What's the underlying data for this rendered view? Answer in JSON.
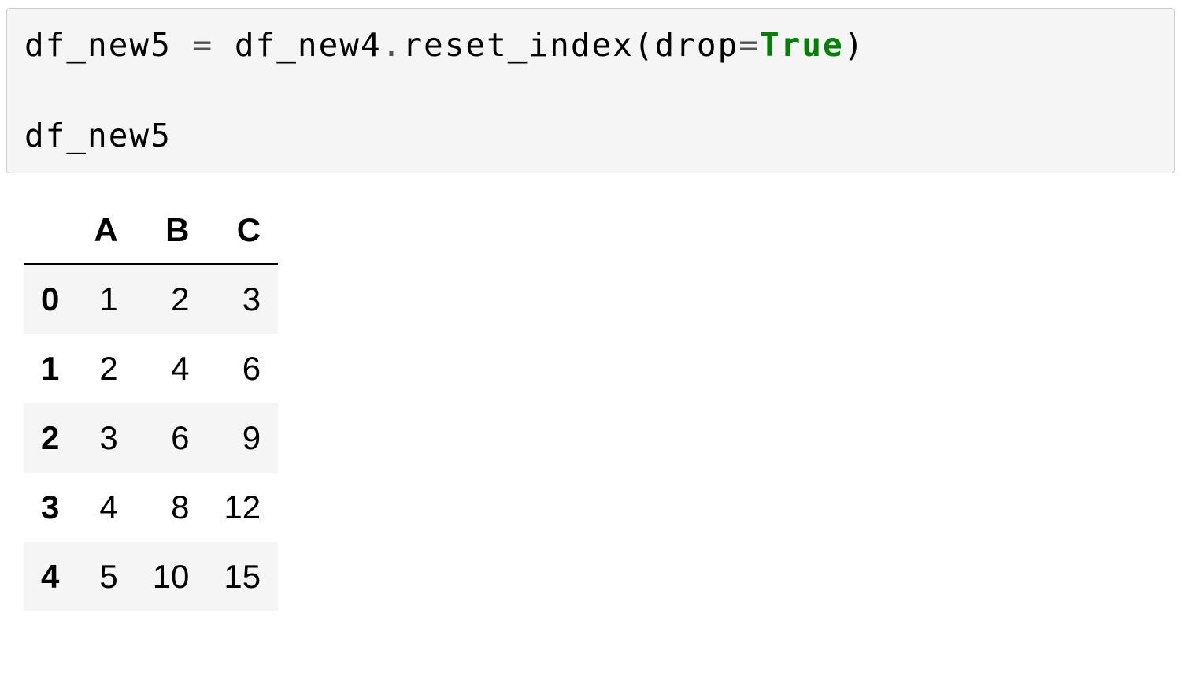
{
  "code": {
    "line1_part1": "df_new5 ",
    "line1_eq": "=",
    "line1_part2": " df_new4",
    "line1_dot": ".",
    "line1_part3": "reset_index(drop",
    "line1_eq2": "=",
    "line1_kw": "True",
    "line1_part4": ")",
    "blank": "",
    "line2": "df_new5"
  },
  "table": {
    "index_label": "",
    "columns": [
      "A",
      "B",
      "C"
    ],
    "index": [
      "0",
      "1",
      "2",
      "3",
      "4"
    ],
    "rows": [
      [
        "1",
        "2",
        "3"
      ],
      [
        "2",
        "4",
        "6"
      ],
      [
        "3",
        "6",
        "9"
      ],
      [
        "4",
        "8",
        "12"
      ],
      [
        "5",
        "10",
        "15"
      ]
    ]
  }
}
